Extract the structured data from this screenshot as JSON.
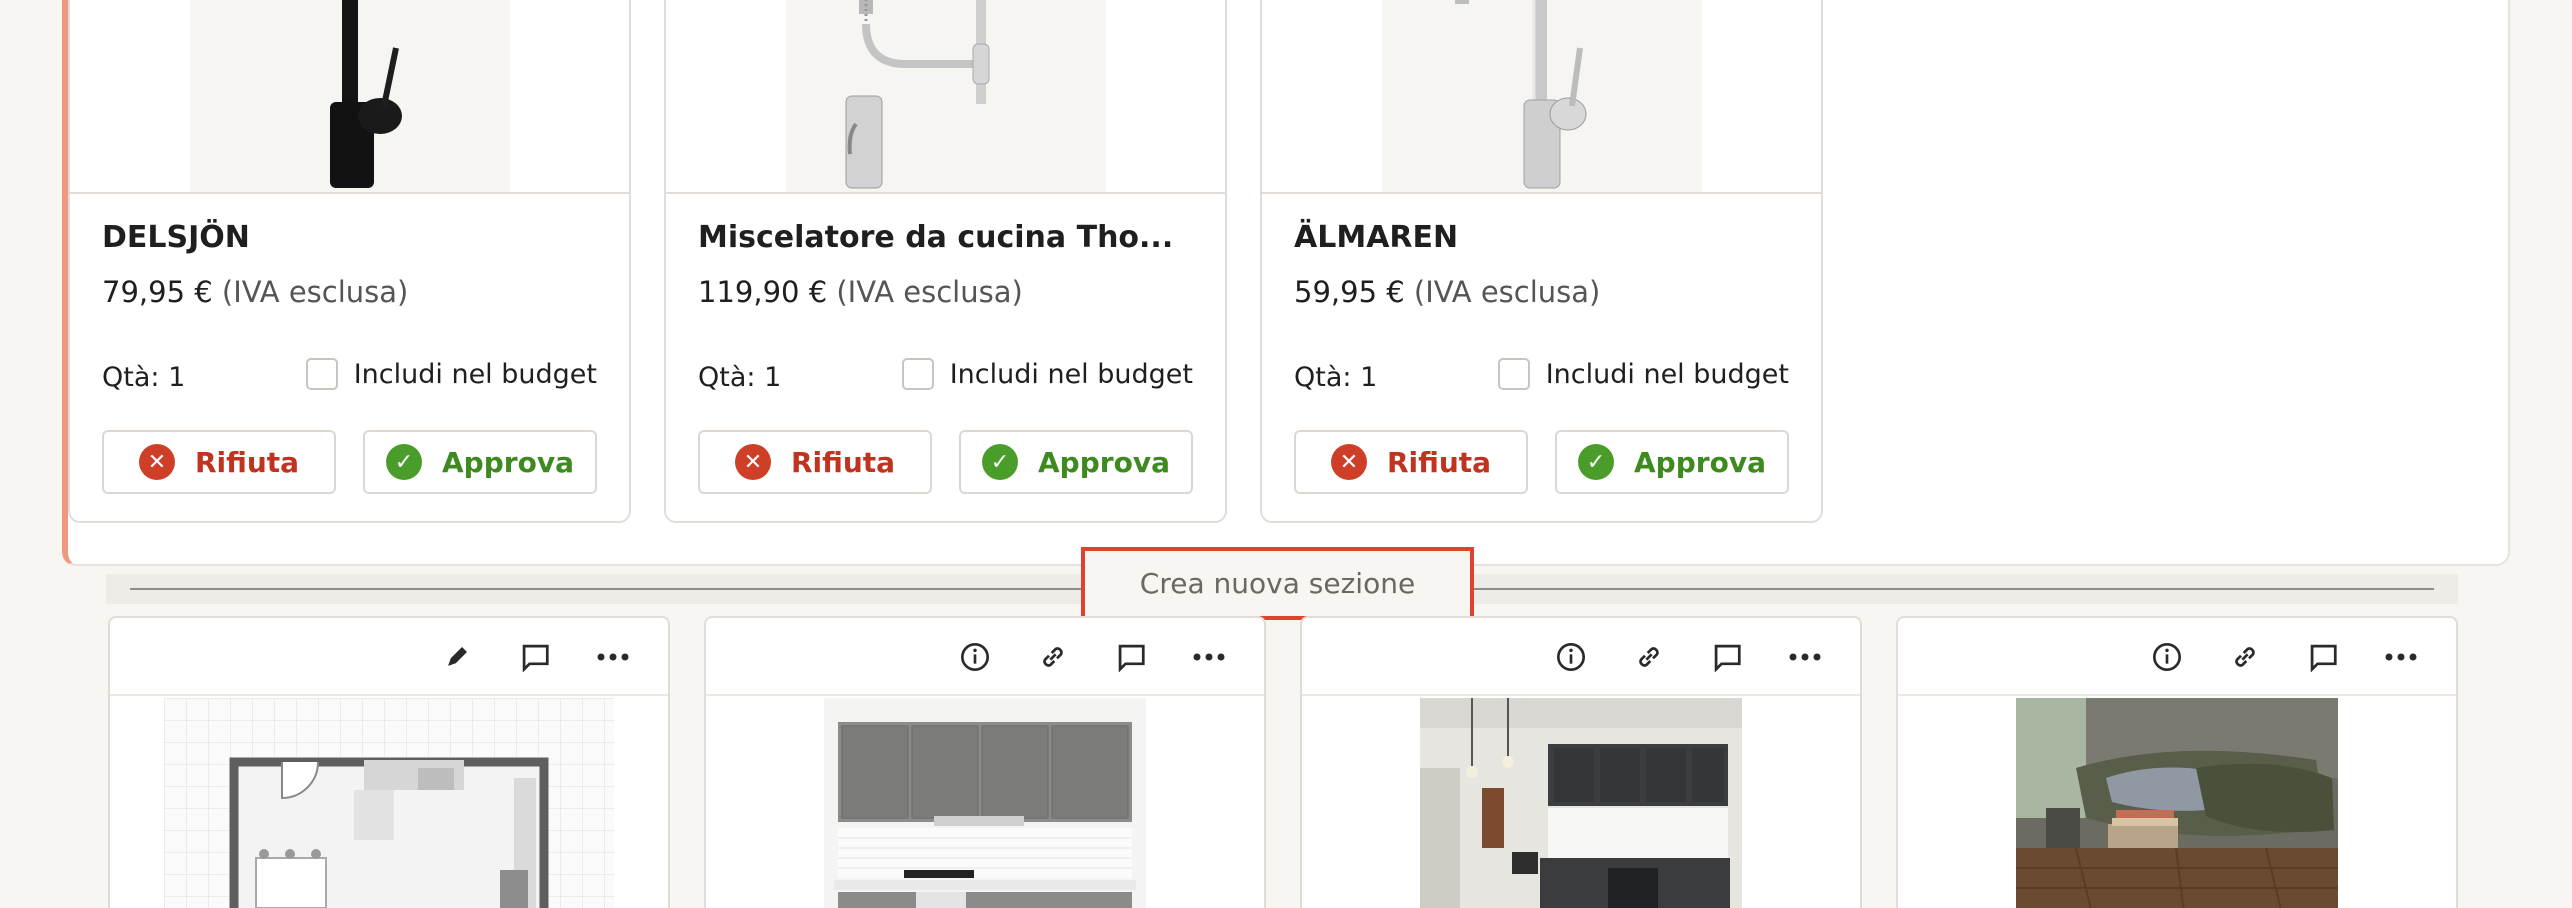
{
  "products": [
    {
      "name": "DELSJÖN",
      "price": "79,95 €",
      "vat": "(IVA esclusa)",
      "qty": "Qtà: 1",
      "budget_label": "Includi nel budget",
      "reject_label": "Rifiuta",
      "approve_label": "Approva",
      "finish": "black"
    },
    {
      "name": "Miscelatore da cucina Tho...",
      "price": "119,90 €",
      "vat": "(IVA esclusa)",
      "qty": "Qtà: 1",
      "budget_label": "Includi nel budget",
      "reject_label": "Rifiuta",
      "approve_label": "Approva",
      "finish": "chrome-spring"
    },
    {
      "name": "ÄLMAREN",
      "price": "59,95 €",
      "vat": "(IVA esclusa)",
      "qty": "Qtà: 1",
      "budget_label": "Includi nel budget",
      "reject_label": "Rifiuta",
      "approve_label": "Approva",
      "finish": "chrome"
    }
  ],
  "divider": {
    "new_section_label": "Crea nuova sezione"
  },
  "icons": {
    "reject": "x-circle-icon",
    "approve": "check-circle-icon",
    "edit": "pencil-icon",
    "info": "info-icon",
    "link": "link-icon",
    "comment": "comment-icon",
    "more": "more-icon"
  },
  "colors": {
    "accent_border": "#ef9a80",
    "reject": "#cf3f28",
    "approve": "#4a9d2a",
    "highlight": "#e3412f"
  }
}
